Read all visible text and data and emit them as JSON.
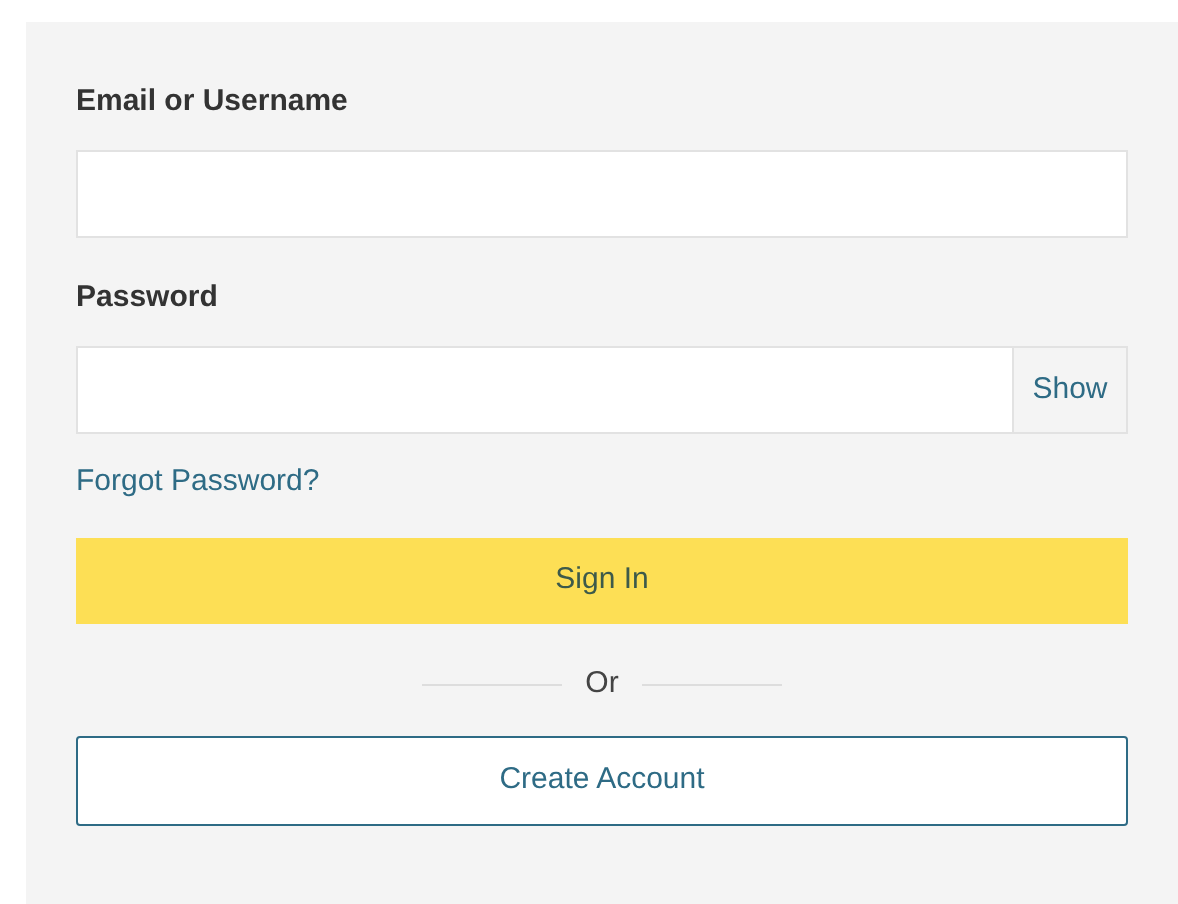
{
  "email_field": {
    "label": "Email or Username"
  },
  "password_field": {
    "label": "Password",
    "toggle": "Show"
  },
  "forgot_link": "Forgot Password?",
  "sign_in_button": "Sign In",
  "divider": "Or",
  "create_account_button": "Create Account"
}
